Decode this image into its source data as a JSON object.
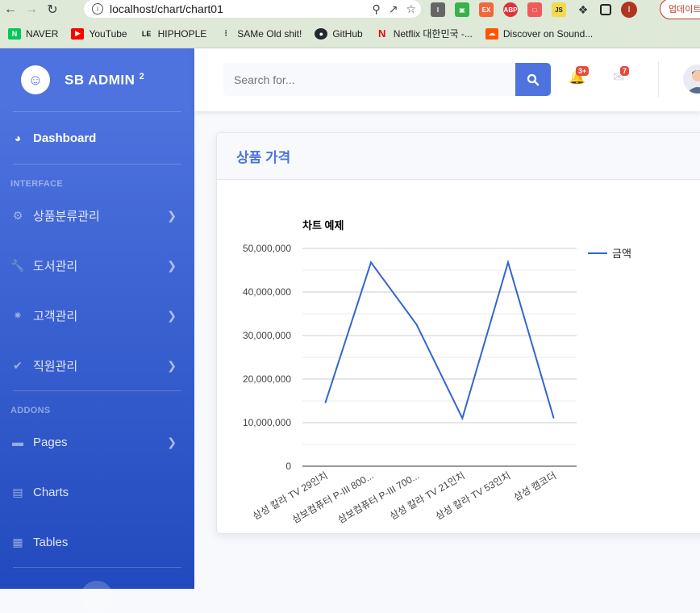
{
  "browser": {
    "url": "localhost/chart/chart01",
    "update_label": "업데이트",
    "profile_initial": "I",
    "bookmarks": [
      {
        "label": "NAVER",
        "icon": "naver-icon",
        "color": "#03c75a"
      },
      {
        "label": "YouTube",
        "icon": "youtube-icon",
        "color": "#ff0000"
      },
      {
        "label": "HIPHOPLE",
        "icon": "hiphople-icon",
        "color": "#111111"
      },
      {
        "label": "SAMe Old shit!",
        "icon": "same-icon",
        "color": "#333333"
      },
      {
        "label": "GitHub",
        "icon": "github-icon",
        "color": "#24292e"
      },
      {
        "label": "Netflix 대한민국 -...",
        "icon": "netflix-icon",
        "color": "#e50914"
      },
      {
        "label": "Discover on Sound...",
        "icon": "soundcloud-icon",
        "color": "#ff5500"
      }
    ]
  },
  "sidebar": {
    "brand": "SB ADMIN",
    "brand_sup": "2",
    "dashboard": "Dashboard",
    "heading_interface": "INTERFACE",
    "heading_addons": "ADDONS",
    "items_interface": [
      {
        "label": "상품분류관리",
        "icon": "gear-icon"
      },
      {
        "label": "도서관리",
        "icon": "wrench-icon"
      },
      {
        "label": "고객관리",
        "icon": "spinner-icon"
      },
      {
        "label": "직원관리",
        "icon": "check-icon"
      }
    ],
    "items_addons": [
      {
        "label": "Pages",
        "icon": "folder-icon"
      },
      {
        "label": "Charts",
        "icon": "chart-area-icon"
      },
      {
        "label": "Tables",
        "icon": "table-icon"
      }
    ]
  },
  "topbar": {
    "search_placeholder": "Search for...",
    "alerts_badge": "3+",
    "messages_badge": "7"
  },
  "card": {
    "title": "상품 가격"
  },
  "chart_data": {
    "type": "line",
    "title": "차트 예제",
    "categories": [
      "삼성 칼라 TV 29인치",
      "삼보컴퓨터 P-III 800...",
      "삼보컴퓨터 P-III 700...",
      "삼성 칼라 TV 21인치",
      "삼성 칼라 TV 53인치",
      "삼성 캠코더"
    ],
    "series": [
      {
        "name": "금액",
        "values": [
          14500000,
          46800000,
          32500000,
          11000000,
          46800000,
          11000000
        ],
        "color": "#3366cc"
      }
    ],
    "yticks": [
      "0",
      "10,000,000",
      "20,000,000",
      "30,000,000",
      "40,000,000",
      "50,000,000"
    ],
    "ylim": [
      0,
      50000000
    ],
    "grid": true,
    "legend": "right"
  }
}
